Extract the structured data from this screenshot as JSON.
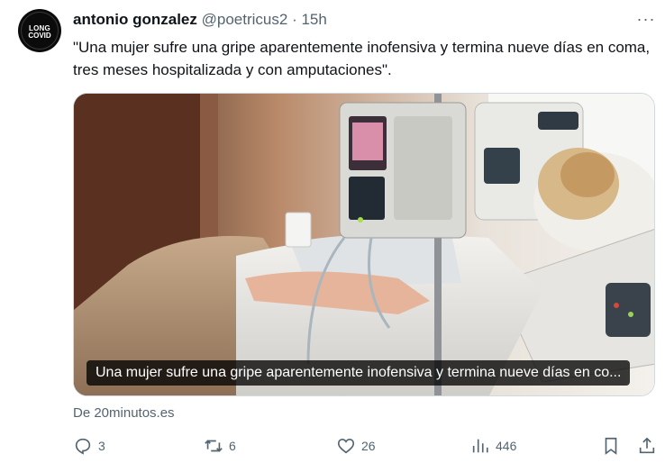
{
  "author": {
    "name": "antonio gonzalez",
    "handle": "@poetricus2",
    "separator": "·",
    "time": "15h",
    "avatar_text_line1": "LONG",
    "avatar_text_line2": "COVID"
  },
  "more_label": "···",
  "tweet_text": "\"Una mujer sufre una gripe aparentemente inofensiva y termina nueve días en coma, tres meses hospitalizada y con amputaciones\".",
  "card": {
    "caption": "Una mujer sufre una gripe aparentemente inofensiva y termina nueve días en co...",
    "source": "De 20minutos.es"
  },
  "actions": {
    "replies": "3",
    "reposts": "6",
    "likes": "26",
    "views": "446"
  },
  "icons": [
    "reply-icon",
    "repost-icon",
    "like-icon",
    "views-icon",
    "bookmark-icon",
    "share-icon",
    "more-icon"
  ]
}
